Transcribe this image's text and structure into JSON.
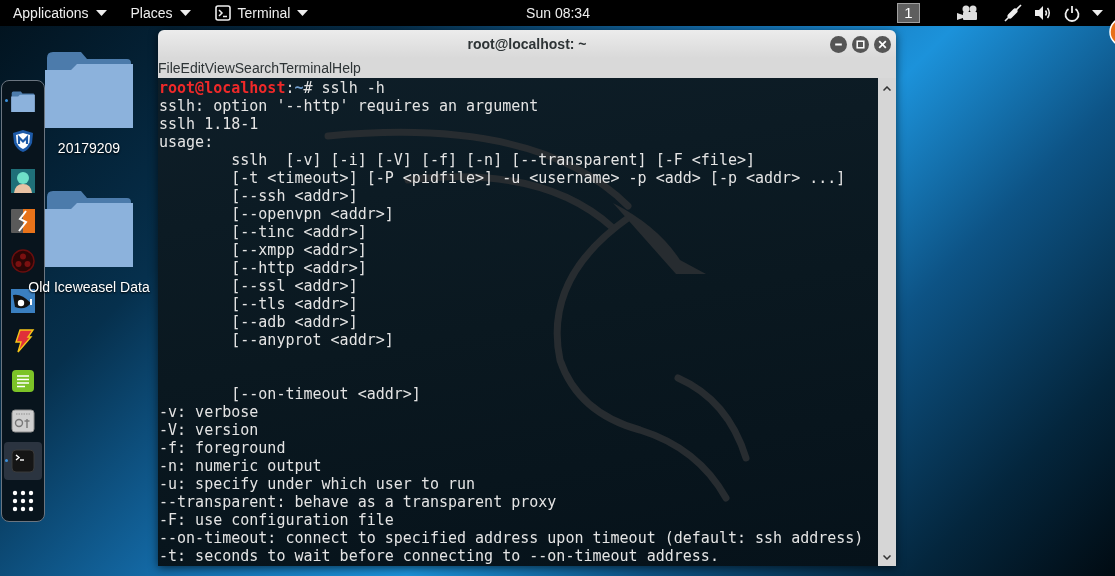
{
  "top_bar": {
    "applications": "Applications",
    "places": "Places",
    "app_menu": "Terminal",
    "clock": "Sun 08:34",
    "workspace": "1"
  },
  "dock": {
    "items": [
      {
        "kind": "folder",
        "running": true,
        "selected": false
      },
      {
        "kind": "shield",
        "running": false,
        "selected": false
      },
      {
        "kind": "avatar",
        "running": false,
        "selected": false
      },
      {
        "kind": "bolt-tile",
        "running": false,
        "selected": false
      },
      {
        "kind": "dots-circle",
        "running": false,
        "selected": false
      },
      {
        "kind": "eye-tile",
        "running": false,
        "selected": false
      },
      {
        "kind": "bolt",
        "running": false,
        "selected": false
      },
      {
        "kind": "notepad",
        "running": false,
        "selected": false
      },
      {
        "kind": "safe",
        "running": false,
        "selected": false
      },
      {
        "kind": "terminal",
        "running": true,
        "selected": true
      },
      {
        "kind": "grid",
        "running": false,
        "selected": false
      }
    ]
  },
  "desktop_icons": [
    {
      "label": "20179209"
    },
    {
      "label": "Old Iceweasel Data"
    }
  ],
  "terminal_window": {
    "title": "root@localhost: ~",
    "menu": [
      "File",
      "Edit",
      "View",
      "Search",
      "Terminal",
      "Help"
    ],
    "prompt": {
      "user_host": "root@localhost",
      "separator": ":",
      "path": "~",
      "symbol": "#",
      "command": "sslh -h"
    },
    "messages": [
      "sslh: option '--http' requires an argument",
      "sslh 1.18-1",
      "usage:"
    ],
    "usage_lines": [
      "sslh  [-v] [-i] [-V] [-f] [-n] [--transparent] [-F <file>]",
      "[-t <timeout>] [-P <pidfile>] -u <username> -p <add> [-p <addr> ...]",
      "[--ssh <addr>]",
      "[--openvpn <addr>]",
      "[--tinc <addr>]",
      "[--xmpp <addr>]",
      "[--http <addr>]",
      "[--ssl <addr>]",
      "[--tls <addr>]",
      "[--adb <addr>]",
      "[--anyprot <addr>]"
    ],
    "timeout_line": "[--on-timeout <addr>]",
    "options": [
      "-v: verbose",
      "-V: version",
      "-f: foreground",
      "-n: numeric output",
      "-u: specify under which user to run",
      "--transparent: behave as a transparent proxy",
      "-F: use configuration file",
      "--on-timeout: connect to specified address upon timeout (default: ssh address)",
      "-t: seconds to wait before connecting to --on-timeout address."
    ]
  }
}
